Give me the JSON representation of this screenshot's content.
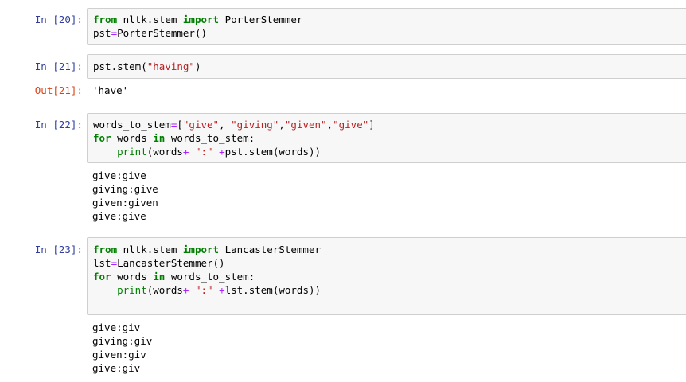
{
  "cells": [
    {
      "prompt": "In [20]:",
      "lines": [
        [
          {
            "t": "from",
            "k": "kw"
          },
          {
            "t": " nltk.stem ",
            "k": ""
          },
          {
            "t": "import",
            "k": "kw"
          },
          {
            "t": " PorterStemmer",
            "k": ""
          }
        ],
        [
          {
            "t": "pst",
            "k": ""
          },
          {
            "t": "=",
            "k": "op"
          },
          {
            "t": "PorterStemmer()",
            "k": ""
          }
        ]
      ]
    },
    {
      "prompt": "In [21]:",
      "lines": [
        [
          {
            "t": "pst.stem(",
            "k": ""
          },
          {
            "t": "\"having\"",
            "k": "str"
          },
          {
            "t": ")",
            "k": ""
          }
        ]
      ],
      "out_prompt": "Out[21]:",
      "output": "'have'"
    },
    {
      "prompt": "In [22]:",
      "lines": [
        [
          {
            "t": "words_to_stem",
            "k": ""
          },
          {
            "t": "=",
            "k": "op"
          },
          {
            "t": "[",
            "k": ""
          },
          {
            "t": "\"give\"",
            "k": "str"
          },
          {
            "t": ", ",
            "k": ""
          },
          {
            "t": "\"giving\"",
            "k": "str"
          },
          {
            "t": ",",
            "k": ""
          },
          {
            "t": "\"given\"",
            "k": "str"
          },
          {
            "t": ",",
            "k": ""
          },
          {
            "t": "\"give\"",
            "k": "str"
          },
          {
            "t": "]",
            "k": ""
          }
        ],
        [
          {
            "t": "for",
            "k": "kw"
          },
          {
            "t": " words ",
            "k": ""
          },
          {
            "t": "in",
            "k": "kw"
          },
          {
            "t": " words_to_stem:",
            "k": ""
          }
        ],
        [
          {
            "t": "    ",
            "k": ""
          },
          {
            "t": "print",
            "k": "bi"
          },
          {
            "t": "(words",
            "k": ""
          },
          {
            "t": "+",
            "k": "op"
          },
          {
            "t": " ",
            "k": ""
          },
          {
            "t": "\":\"",
            "k": "str"
          },
          {
            "t": " ",
            "k": ""
          },
          {
            "t": "+",
            "k": "op"
          },
          {
            "t": "pst.stem(words))",
            "k": ""
          }
        ]
      ],
      "output": "give:give\ngiving:give\ngiven:given\ngive:give"
    },
    {
      "prompt": "In [23]:",
      "lines": [
        [
          {
            "t": "from",
            "k": "kw"
          },
          {
            "t": " nltk.stem ",
            "k": ""
          },
          {
            "t": "import",
            "k": "kw"
          },
          {
            "t": " LancasterStemmer",
            "k": ""
          }
        ],
        [
          {
            "t": "lst",
            "k": ""
          },
          {
            "t": "=",
            "k": "op"
          },
          {
            "t": "LancasterStemmer()",
            "k": ""
          }
        ],
        [
          {
            "t": "for",
            "k": "kw"
          },
          {
            "t": " words ",
            "k": ""
          },
          {
            "t": "in",
            "k": "kw"
          },
          {
            "t": " words_to_stem:",
            "k": ""
          }
        ],
        [
          {
            "t": "    ",
            "k": ""
          },
          {
            "t": "print",
            "k": "bi"
          },
          {
            "t": "(words",
            "k": ""
          },
          {
            "t": "+",
            "k": "op"
          },
          {
            "t": " ",
            "k": ""
          },
          {
            "t": "\":\"",
            "k": "str"
          },
          {
            "t": " ",
            "k": ""
          },
          {
            "t": "+",
            "k": "op"
          },
          {
            "t": "lst.stem(words))",
            "k": ""
          }
        ]
      ],
      "output": "give:giv\ngiving:giv\ngiven:giv\ngive:giv"
    }
  ]
}
